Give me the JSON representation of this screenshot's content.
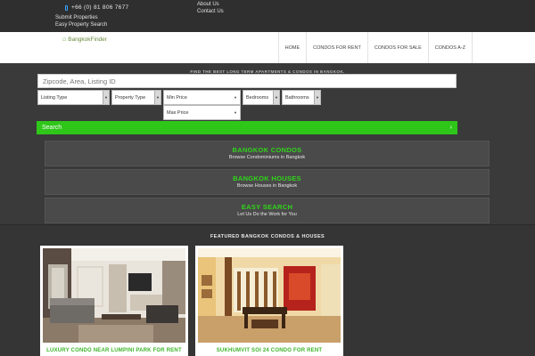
{
  "topbar": {
    "phone": "+66 (0) 81 806 7677",
    "links": [
      "Submit Properties",
      "Easy Property Search",
      "About Us",
      "Contact Us"
    ]
  },
  "header": {
    "logo": "BangkokFinder",
    "nav": [
      "HOME",
      "CONDOS FOR RENT",
      "CONDOS FOR SALE",
      "CONDOS A-Z"
    ]
  },
  "search": {
    "tagline": "FIND THE BEST LONG TERM APARTMENTS & CONDOS IN BANGKOK.",
    "keyword_placeholder": "Zipcode, Area, Listing ID",
    "listing_type": "Listing Type",
    "property_type": "Property Type",
    "min_price": "Min Price",
    "bedrooms": "Bedrooms",
    "bathrooms": "Bathrooms",
    "max_price": "Max Price",
    "button": "Search",
    "button_arrow": "›"
  },
  "categories": [
    {
      "title": "BANGKOK CONDOS",
      "subtitle": "Browse Condominiums in Bangkok"
    },
    {
      "title": "BANGKOK HOUSES",
      "subtitle": "Browse Houses in Bangkok"
    },
    {
      "title": "EASY SEARCH",
      "subtitle": "Let Us Do the Work for You"
    }
  ],
  "featured": {
    "title": "FEATURED BANGKOK CONDOS & HOUSES",
    "cards": [
      {
        "title": "LUXURY CONDO NEAR LUMPINI PARK FOR RENT"
      },
      {
        "title": "SUKHUMVIT SOI 24 CONDO FOR RENT"
      }
    ]
  },
  "colors": {
    "accent_green": "#2fc61a",
    "dark_bg": "#3a3a3a"
  }
}
